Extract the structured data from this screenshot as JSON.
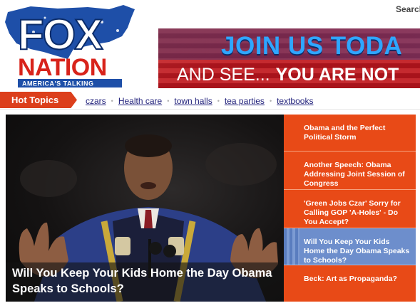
{
  "header": {
    "search_label": "Search",
    "logo": {
      "wordmark_top": "FOX",
      "wordmark_bottom": "NATION",
      "tagline": "AMERICA'S TALKING",
      "icon": "us-map-icon"
    }
  },
  "banner": {
    "line1": "JOIN US TODA",
    "line2_a": "AND SEE...",
    "line2_b": "YOU ARE NOT"
  },
  "hot_topics": {
    "label": "Hot Topics",
    "items": [
      "czars",
      "Health care",
      "town halls",
      "tea parties",
      "textbooks"
    ],
    "separator": "•"
  },
  "feature": {
    "caption": "Will You Keep Your Kids Home the Day Obama Speaks to Schools?"
  },
  "stories": [
    {
      "title": "Obama and the Perfect Political Storm",
      "active": false
    },
    {
      "title": "Another Speech: Obama Addressing Joint Session of Congress",
      "active": false
    },
    {
      "title": "'Green Jobs Czar' Sorry for Calling GOP 'A-Holes' - Do You Accept?",
      "active": false
    },
    {
      "title": "Will You Keep Your Kids Home the Day Obama Speaks to Schools?",
      "active": true
    },
    {
      "title": "Beck: Art as Propaganda?",
      "active": false
    }
  ],
  "colors": {
    "accent_orange": "#e84a17",
    "active_blue": "#6d8ecc",
    "logo_blue": "#1e4fa8",
    "logo_red": "#d8231b"
  }
}
